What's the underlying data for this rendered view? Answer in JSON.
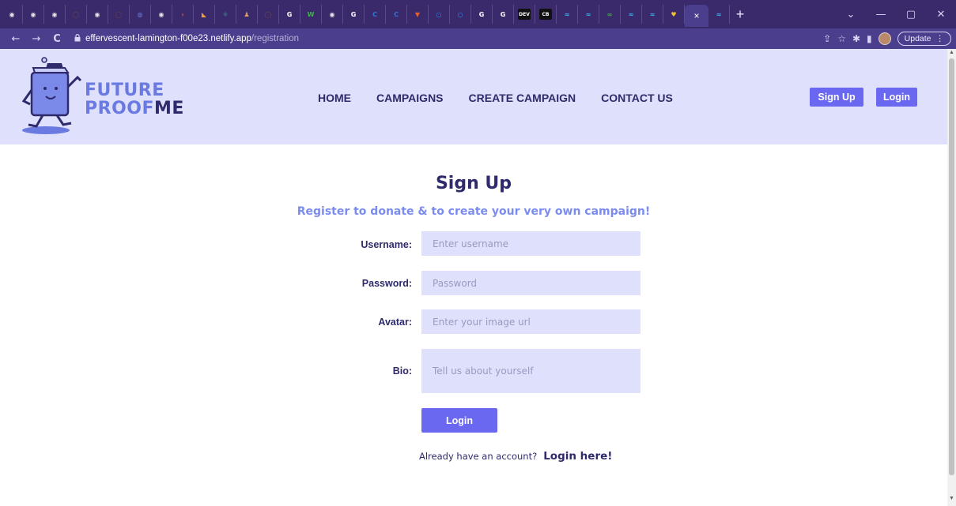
{
  "browser": {
    "favicons": [
      {
        "icon": "github-icon",
        "color": "#e6e6e6",
        "glyph": "◉"
      },
      {
        "icon": "github-icon",
        "color": "#e6e6e6",
        "glyph": "◉"
      },
      {
        "icon": "github-icon",
        "color": "#e6e6e6",
        "glyph": "◉"
      },
      {
        "icon": "octocat-icon",
        "color": "#6b4a3a",
        "glyph": "◯"
      },
      {
        "icon": "github-icon",
        "color": "#e6e6e6",
        "glyph": "◉"
      },
      {
        "icon": "octocat-icon",
        "color": "#6b4a3a",
        "glyph": "◯"
      },
      {
        "icon": "planet-icon",
        "color": "#6a7bd8",
        "glyph": "◍"
      },
      {
        "icon": "github-icon",
        "color": "#e6e6e6",
        "glyph": "◉"
      },
      {
        "icon": "arrow-icon",
        "color": "#e0603a",
        "glyph": "›"
      },
      {
        "icon": "chart-icon",
        "color": "#e8a03a",
        "glyph": "◣"
      },
      {
        "icon": "react-icon",
        "color": "#2fa89a",
        "glyph": "⚛"
      },
      {
        "icon": "figure-icon",
        "color": "#d89a6a",
        "glyph": "♟"
      },
      {
        "icon": "octocat-icon",
        "color": "#6b4a3a",
        "glyph": "◯"
      },
      {
        "icon": "google-icon",
        "color": "#ffffff",
        "glyph": "G"
      },
      {
        "icon": "w-icon",
        "color": "#3fb54a",
        "glyph": "W"
      },
      {
        "icon": "github-icon",
        "color": "#e6e6e6",
        "glyph": "◉"
      },
      {
        "icon": "google-icon",
        "color": "#ffffff",
        "glyph": "G"
      },
      {
        "icon": "c-icon",
        "color": "#2a7ad8",
        "glyph": "C"
      },
      {
        "icon": "c-icon",
        "color": "#2a7ad8",
        "glyph": "C"
      },
      {
        "icon": "shield-icon",
        "color": "#e8602a",
        "glyph": "▼"
      },
      {
        "icon": "circle-icon",
        "color": "#2a8af0",
        "glyph": "○"
      },
      {
        "icon": "circle-icon",
        "color": "#2a8af0",
        "glyph": "○"
      },
      {
        "icon": "google-icon",
        "color": "#ffffff",
        "glyph": "G"
      },
      {
        "icon": "google-icon",
        "color": "#ffffff",
        "glyph": "G"
      },
      {
        "icon": "dev-icon",
        "color": "#111111",
        "glyph": "DEV"
      },
      {
        "icon": "cb-icon",
        "color": "#2a7ad8",
        "glyph": "CB"
      },
      {
        "icon": "tailwind-icon",
        "color": "#38bdf8",
        "glyph": "≈"
      },
      {
        "icon": "tailwind-icon",
        "color": "#38bdf8",
        "glyph": "≈"
      },
      {
        "icon": "infinity-icon",
        "color": "#3fb54a",
        "glyph": "∞"
      },
      {
        "icon": "tailwind-icon",
        "color": "#38bdf8",
        "glyph": "≈"
      },
      {
        "icon": "tailwind-icon",
        "color": "#38bdf8",
        "glyph": "≈"
      },
      {
        "icon": "heart-icon",
        "color": "#f0c030",
        "glyph": "♥"
      }
    ],
    "active_tab_close": "×",
    "after_tab_icon": "≈",
    "new_tab": "+",
    "window_controls": {
      "dropdown": "⌄",
      "minimize": "—",
      "restore": "▢",
      "close": "✕"
    },
    "nav": {
      "back": "←",
      "forward": "→",
      "reload": "C"
    },
    "url_host": "effervescent-lamington-f00e23.netlify.app",
    "url_path": "/registration",
    "toolbar_icons": {
      "share": "⇪",
      "star": "☆",
      "extensions": "✱",
      "sidepanel": "▮"
    },
    "update_label": "Update",
    "update_menu": "⋮"
  },
  "header": {
    "logo_line1": "FUTURE",
    "logo_line2a": "PROOF",
    "logo_line2b": "ME",
    "nav": [
      "HOME",
      "CAMPAIGNS",
      "CREATE CAMPAIGN",
      "CONTACT US"
    ],
    "signup_label": "Sign Up",
    "login_label": "Login"
  },
  "form": {
    "title": "Sign Up",
    "subtitle": "Register to donate & to create your very own campaign!",
    "username_label": "Username:",
    "username_placeholder": "Enter username",
    "password_label": "Password:",
    "password_placeholder": "Password",
    "avatar_label": "Avatar:",
    "avatar_placeholder": "Enter your image url",
    "bio_label": "Bio:",
    "bio_placeholder": "Tell us about yourself",
    "submit_label": "Login",
    "already_text": "Already have an account?",
    "login_link": "Login here!"
  },
  "colors": {
    "accent": "#6a67f0",
    "header_bg": "#dfe0fc",
    "dark_text": "#2e2a6b",
    "subtitle": "#7b8cf0",
    "chrome_bg": "#3b2a6b"
  }
}
